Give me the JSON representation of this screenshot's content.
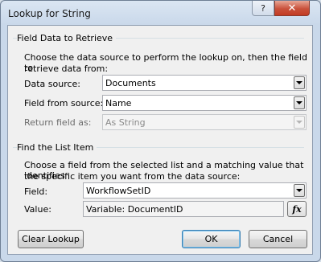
{
  "window": {
    "title": "Lookup for String",
    "help_label": "?",
    "close_label": "✕"
  },
  "retrieve_group": {
    "title": "Field Data to Retrieve",
    "description_line1": "Choose the data source to perform the lookup on, then the field to",
    "description_line2": "retrieve data from:",
    "data_source_label": "Data source:",
    "data_source_value": "Documents",
    "field_from_source_label": "Field from source:",
    "field_from_source_value": "Name",
    "return_field_label": "Return field as:",
    "return_field_value": "As String"
  },
  "find_group": {
    "title": "Find the List Item",
    "description_line1": "Choose a field from the selected list and a matching value that identifies",
    "description_line2": "the specific item you want from the data source:",
    "field_label": "Field:",
    "field_value": "WorkflowSetID",
    "value_label": "Value:",
    "value_value": "Variable: DocumentID",
    "fx_label": "fx"
  },
  "buttons": {
    "clear_lookup": "Clear Lookup",
    "ok": "OK",
    "cancel": "Cancel"
  }
}
